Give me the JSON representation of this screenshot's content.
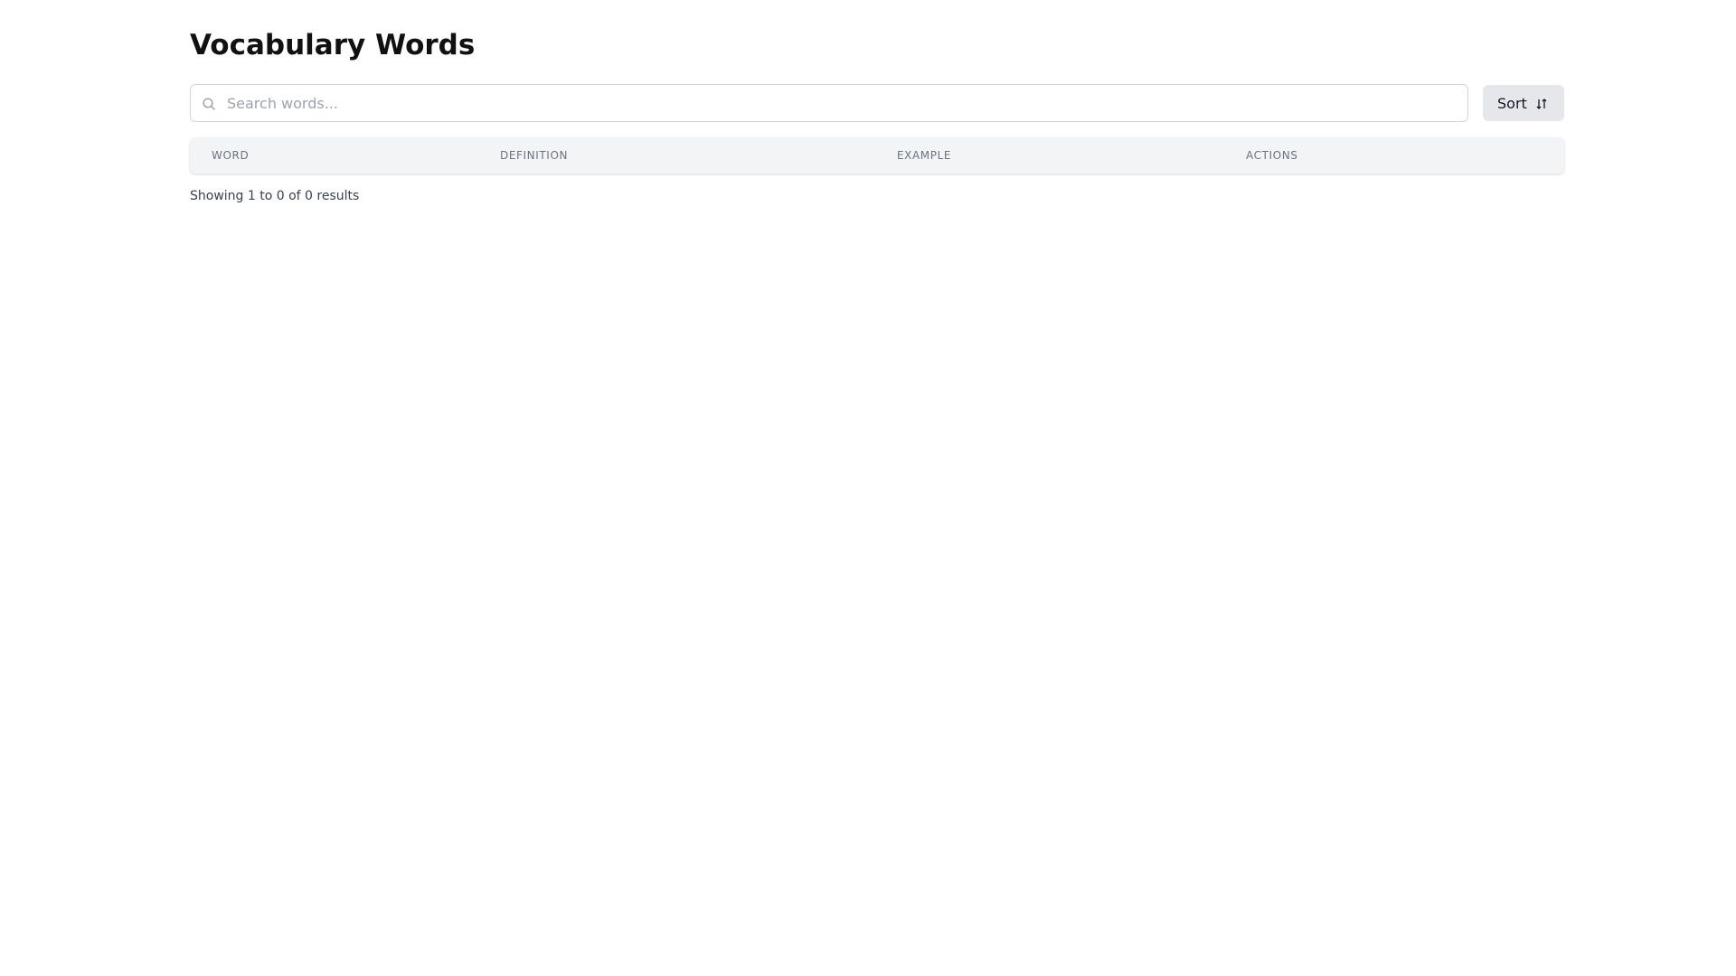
{
  "page": {
    "title": "Vocabulary Words"
  },
  "search": {
    "placeholder": "Search words...",
    "value": "",
    "icon": "search-icon"
  },
  "sort": {
    "label": "Sort",
    "icon": "sort-icon"
  },
  "table": {
    "columns": [
      "WORD",
      "DEFINITION",
      "EXAMPLE",
      "ACTIONS"
    ],
    "rows": []
  },
  "pagination": {
    "summary": "Showing 1 to 0 of 0 results"
  },
  "colors": {
    "header_bg": "#f3f4f6",
    "sort_button_bg": "#e5e7eb",
    "border": "#d1d5db"
  }
}
